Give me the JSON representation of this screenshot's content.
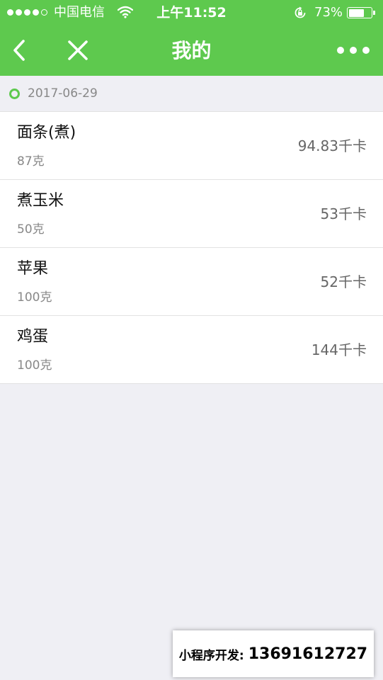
{
  "status_bar": {
    "carrier": "中国电信",
    "time": "上午11:52",
    "battery_percent": "73%",
    "battery_level": 0.73,
    "signal_bars_filled": 4,
    "signal_bars_total": 5,
    "icons": [
      "wifi-icon",
      "rotation-lock-icon",
      "battery-icon"
    ]
  },
  "nav": {
    "title": "我的",
    "back_icon": "chevron-left-icon",
    "close_icon": "close-icon",
    "more_icon": "more-dots-icon"
  },
  "date": "2017-06-29",
  "foods": [
    {
      "name": "面条(煮)",
      "weight": "87克",
      "calories": "94.83千卡"
    },
    {
      "name": "煮玉米",
      "weight": "50克",
      "calories": "53千卡"
    },
    {
      "name": "苹果",
      "weight": "100克",
      "calories": "52千卡"
    },
    {
      "name": "鸡蛋",
      "weight": "100克",
      "calories": "144千卡"
    }
  ],
  "banner": {
    "label": "小程序开发:",
    "phone": "13691612727"
  },
  "colors": {
    "accent": "#5ec94e",
    "background": "#efeff4"
  }
}
